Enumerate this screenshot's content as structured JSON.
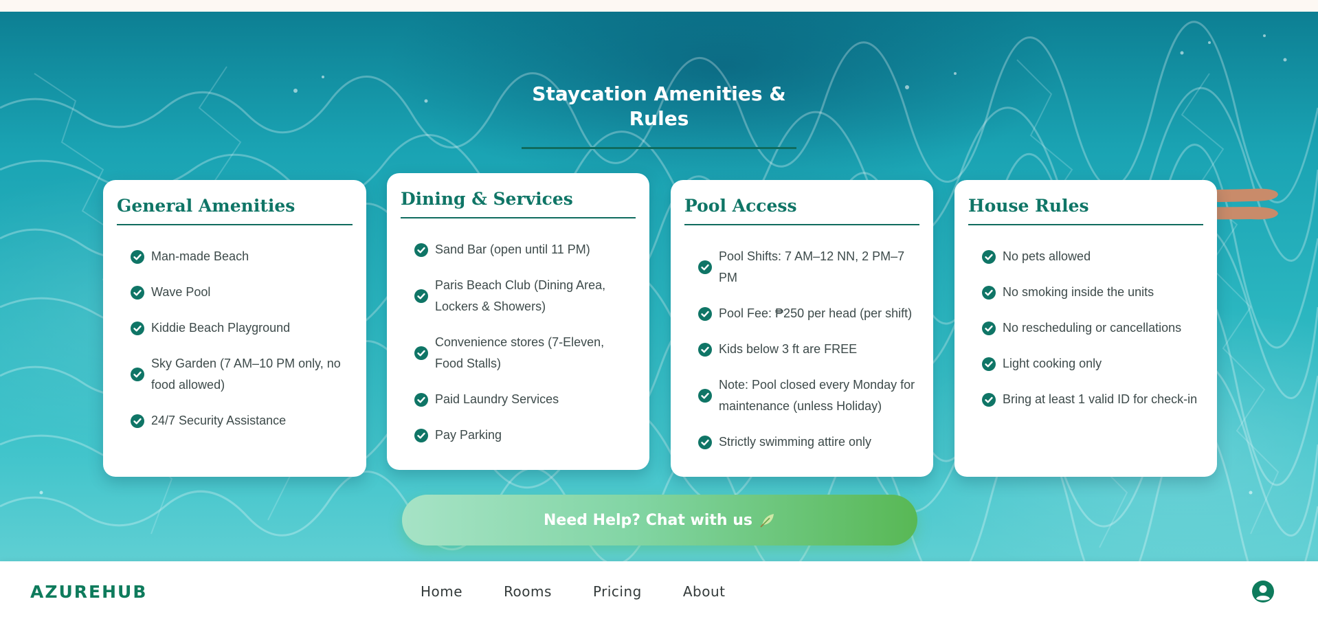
{
  "section": {
    "title": "Staycation Amenities & Rules"
  },
  "cards": [
    {
      "title": "General Amenities",
      "items": [
        "Man-made Beach",
        "Wave Pool",
        "Kiddie Beach Playground",
        "Sky Garden (7 AM–10 PM only, no food allowed)",
        "24/7 Security Assistance"
      ]
    },
    {
      "title": "Dining & Services",
      "items": [
        "Sand Bar (open until 11 PM)",
        "Paris Beach Club (Dining Area, Lockers & Showers)",
        "Convenience stores (7-Eleven, Food Stalls)",
        "Paid Laundry Services",
        "Pay Parking"
      ]
    },
    {
      "title": "Pool Access",
      "items": [
        "Pool Shifts: 7 AM–12 NN, 2 PM–7 PM",
        "Pool Fee: ₱250 per head (per shift)",
        "Kids below 3 ft are FREE",
        "Note: Pool closed every Monday for maintenance (unless Holiday)",
        "Strictly swimming attire only"
      ]
    },
    {
      "title": "House Rules",
      "items": [
        "No pets allowed",
        "No smoking inside the units",
        "No rescheduling or cancellations",
        "Light cooking only",
        "Bring at least 1 valid ID for check-in"
      ]
    }
  ],
  "cta": {
    "label": "Need Help? Chat with us",
    "icon": "leaf-icon"
  },
  "navbar": {
    "brand": "AZUREHUB",
    "links": [
      "Home",
      "Rooms",
      "Pricing",
      "About"
    ],
    "user_icon": "user-circle-icon"
  },
  "colors": {
    "accent": "#0f7566",
    "cta_start": "#a6e3c6",
    "cta_end": "#58b855",
    "water": "#2bb6c0"
  }
}
